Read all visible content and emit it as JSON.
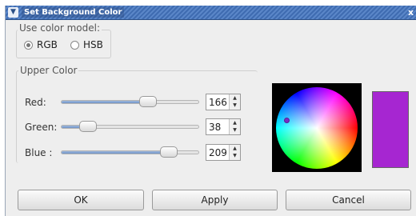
{
  "window": {
    "title": "Set Background Color",
    "menu_icon": "chevron-down-icon",
    "close_icon": "close-icon",
    "close_glyph": "x"
  },
  "model": {
    "label": "Use color model:",
    "options": [
      {
        "label": "RGB",
        "checked": true
      },
      {
        "label": "HSB",
        "checked": false
      }
    ]
  },
  "upper_color": {
    "label": "Upper Color",
    "red": {
      "label": "Red:",
      "value": "166",
      "max": 255
    },
    "green": {
      "label": "Green:",
      "value": "38",
      "max": 255
    },
    "blue": {
      "label": "Blue :",
      "value": "209",
      "max": 255
    }
  },
  "swatch_color": "#a626d1",
  "wheel_marker_color": "#7a2cc6",
  "buttons": {
    "ok": "OK",
    "apply": "Apply",
    "cancel": "Cancel"
  }
}
